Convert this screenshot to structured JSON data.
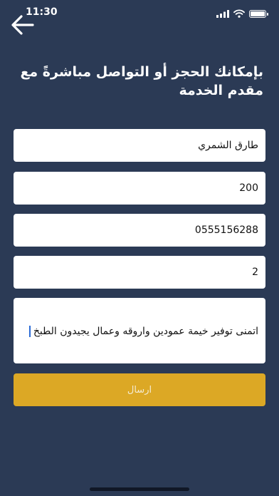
{
  "status_bar": {
    "time": "11:30",
    "battery_level": 0.9
  },
  "header": {
    "back_icon": "arrow-left-icon"
  },
  "title": "بإمكانك الحجز  أو التواصل مباشرةً مع مقدم الخدمة",
  "form": {
    "name_value": "طارق الشمري",
    "amount_value": "200",
    "phone_value": "0555156288",
    "count_value": "2",
    "notes_value": "اتمنى توفير خيمة عمودين واروقه وعمال يجيدون الطبخ"
  },
  "submit_label": "ارسال",
  "colors": {
    "background": "#2b3a55",
    "accent": "#dca825"
  }
}
